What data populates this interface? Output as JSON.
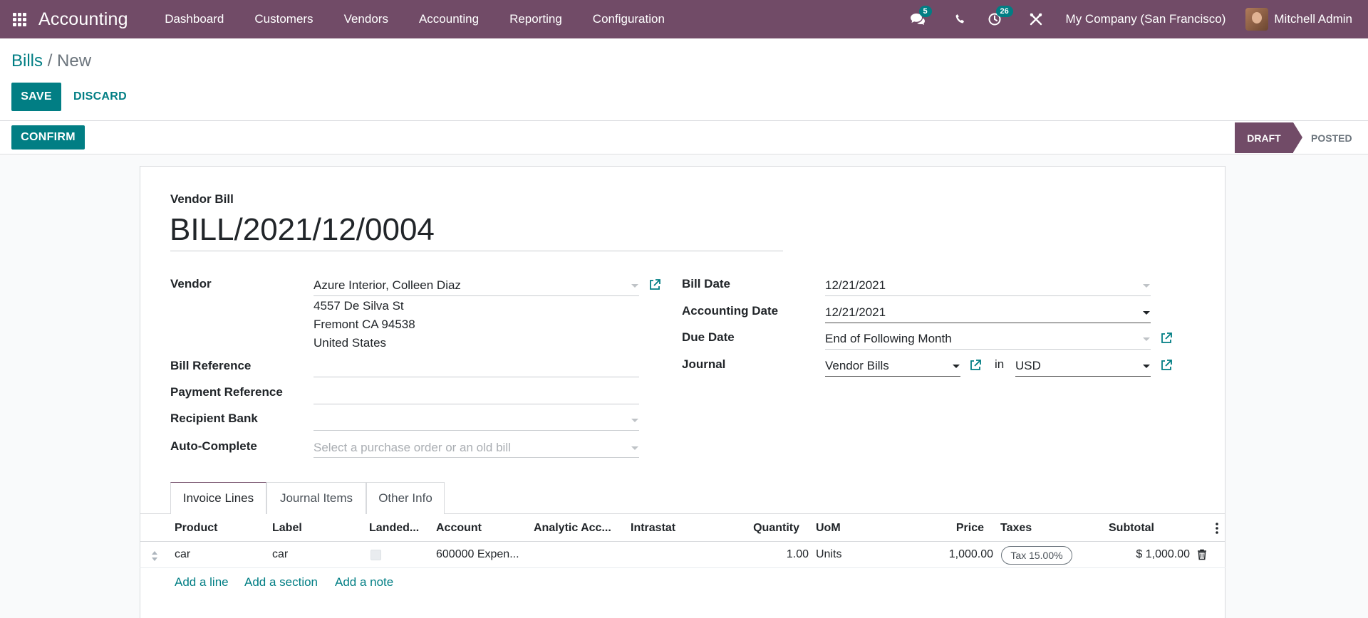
{
  "navbar": {
    "brand": "Accounting",
    "menu": [
      "Dashboard",
      "Customers",
      "Vendors",
      "Accounting",
      "Reporting",
      "Configuration"
    ],
    "messages_count": "5",
    "activities_count": "26",
    "company": "My Company (San Francisco)",
    "user": "Mitchell Admin"
  },
  "breadcrumb": {
    "parent": "Bills",
    "separator": "/",
    "current": "New"
  },
  "actions": {
    "save": "SAVE",
    "discard": "DISCARD",
    "confirm": "CONFIRM"
  },
  "status": {
    "draft": "DRAFT",
    "posted": "POSTED"
  },
  "form": {
    "type_label": "Vendor Bill",
    "number": "BILL/2021/12/0004",
    "vendor_label": "Vendor",
    "vendor": "Azure Interior, Colleen Diaz",
    "address": [
      "4557 De Silva St",
      "Fremont CA 94538",
      "United States"
    ],
    "bill_reference_label": "Bill Reference",
    "payment_reference_label": "Payment Reference",
    "recipient_bank_label": "Recipient Bank",
    "auto_complete_label": "Auto-Complete",
    "auto_complete_placeholder": "Select a purchase order or an old bill",
    "bill_date_label": "Bill Date",
    "bill_date": "12/21/2021",
    "accounting_date_label": "Accounting Date",
    "accounting_date": "12/21/2021",
    "due_date_label": "Due Date",
    "due_date": "End of Following Month",
    "journal_label": "Journal",
    "journal": "Vendor Bills",
    "in_label": "in",
    "currency": "USD"
  },
  "tabs": [
    "Invoice Lines",
    "Journal Items",
    "Other Info"
  ],
  "lines": {
    "headers": {
      "product": "Product",
      "label": "Label",
      "landed": "Landed...",
      "account": "Account",
      "analytic": "Analytic Acc...",
      "intrastat": "Intrastat",
      "quantity": "Quantity",
      "uom": "UoM",
      "price": "Price",
      "taxes": "Taxes",
      "subtotal": "Subtotal"
    },
    "row": {
      "product": "car",
      "label": "car",
      "account": "600000 Expen...",
      "quantity": "1.00",
      "uom": "Units",
      "price": "1,000.00",
      "tax": "Tax 15.00%",
      "subtotal": "$ 1,000.00"
    },
    "add_line": "Add a line",
    "add_section": "Add a section",
    "add_note": "Add a note"
  }
}
